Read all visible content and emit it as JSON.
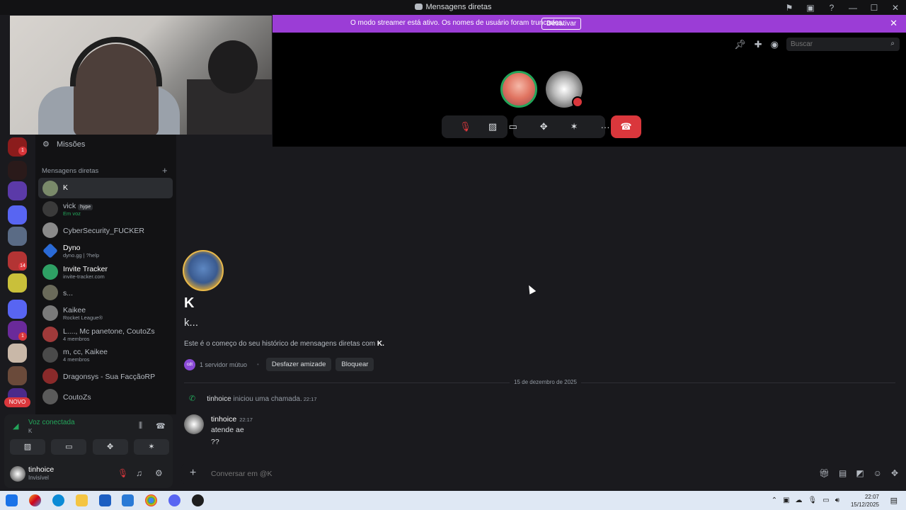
{
  "window": {
    "title": "Mensagens diretas"
  },
  "banner": {
    "text": "O modo streamer está ativo. Os nomes de usuário foram truncados.",
    "button": "Desativar",
    "close": "✕"
  },
  "call": {
    "search_placeholder": "Buscar",
    "hangup_icon": "phone-hangup-icon"
  },
  "sidebar": {
    "missions_label": "Missões",
    "dm_header": "Mensagens diretas",
    "dms": [
      {
        "name": "K",
        "sub": "",
        "active": true
      },
      {
        "name": "vick",
        "sub": "Em voz",
        "badge": "hype"
      },
      {
        "name": "CyberSecurity_FUCKER",
        "sub": ""
      },
      {
        "name": "Dyno",
        "sub": "dyno.gg | ?help"
      },
      {
        "name": "Invite Tracker",
        "sub": "invite-tracker.com"
      },
      {
        "name": "s...",
        "sub": ""
      },
      {
        "name": "Kaikee",
        "sub": "Rocket League®"
      },
      {
        "name": "L...., Mc panetone, CoutoZs",
        "sub": "4 membros"
      },
      {
        "name": "m, cc, Kaikee",
        "sub": "4 membros"
      },
      {
        "name": "Dragonsys - Sua FacçãoRP",
        "sub": ""
      },
      {
        "name": "CoutoZs",
        "sub": ""
      }
    ],
    "server_badges": [
      "1",
      "14",
      "1"
    ],
    "novo_label": "NOVO"
  },
  "voice": {
    "title": "Voz conectada",
    "sub": "K"
  },
  "user": {
    "name": "tinhoice",
    "status": "Invisível"
  },
  "chat": {
    "name": "K",
    "handle": "k...",
    "intro_prefix": "Este é o começo do seu histórico de mensagens diretas com ",
    "intro_name": "K.",
    "mutual_avatar_text": "cdt",
    "mutual": "1 servidor mútuo",
    "unfriend": "Desfazer amizade",
    "block": "Bloquear",
    "date": "15 de dezembro de 2025",
    "call_user": "tinhoice",
    "call_text": " iniciou uma chamada.",
    "call_time": "22:17",
    "msg_user": "tinhoice",
    "msg_time": "22:17",
    "msg_lines": [
      "atende ae",
      "??"
    ],
    "composer_placeholder": "Conversar em @K"
  },
  "taskbar": {
    "time": "22:07",
    "date": "15/12/2025"
  }
}
